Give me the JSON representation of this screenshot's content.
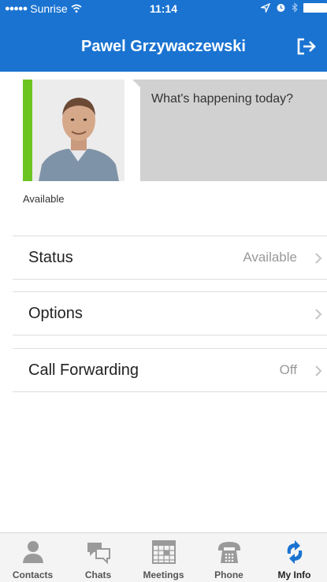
{
  "status_bar": {
    "carrier": "Sunrise",
    "signal_dots": "●●●●●",
    "time": "11:14"
  },
  "header": {
    "title": "Pawel Grzywaczewski",
    "logout_icon": "logout-arrow-icon"
  },
  "profile": {
    "availability": "Available",
    "availability_color": "#6cc421",
    "note_placeholder": "What's happening today?"
  },
  "settings": [
    {
      "label": "Status",
      "value": "Available"
    },
    {
      "label": "Options",
      "value": ""
    },
    {
      "label": "Call Forwarding",
      "value": "Off"
    }
  ],
  "tabs": [
    {
      "label": "Contacts",
      "icon": "contacts-icon",
      "active": false
    },
    {
      "label": "Chats",
      "icon": "chats-icon",
      "active": false
    },
    {
      "label": "Meetings",
      "icon": "meetings-icon",
      "active": false
    },
    {
      "label": "Phone",
      "icon": "phone-icon",
      "active": false
    },
    {
      "label": "My Info",
      "icon": "my-info-icon",
      "active": true
    }
  ],
  "colors": {
    "header_bg": "#1a73d1",
    "active_tab": "#1a73d1"
  }
}
